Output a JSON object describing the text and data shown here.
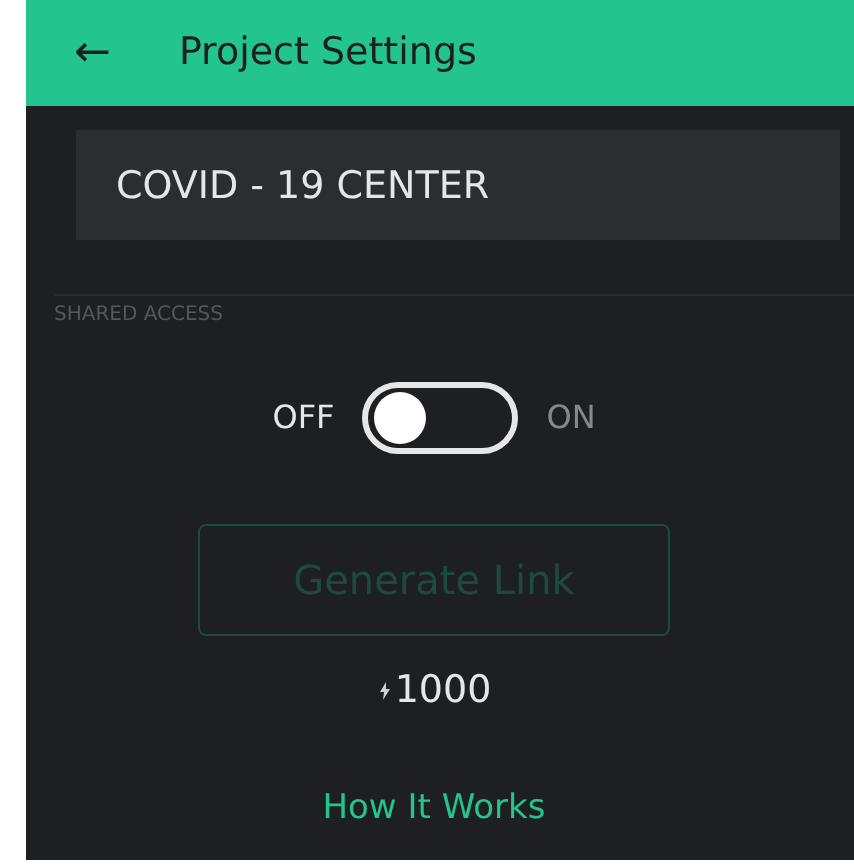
{
  "header": {
    "back": "←",
    "title": "Project Settings"
  },
  "project_name": {
    "value": "COVID - 19 CENTER"
  },
  "shared_access": {
    "label": "SHARED ACCESS",
    "off_label": "OFF",
    "on_label": "ON",
    "on": false
  },
  "generate_button": {
    "label": "Generate Link",
    "disabled": true
  },
  "energy": {
    "amount": "1000"
  },
  "help_link": "How It Works"
}
